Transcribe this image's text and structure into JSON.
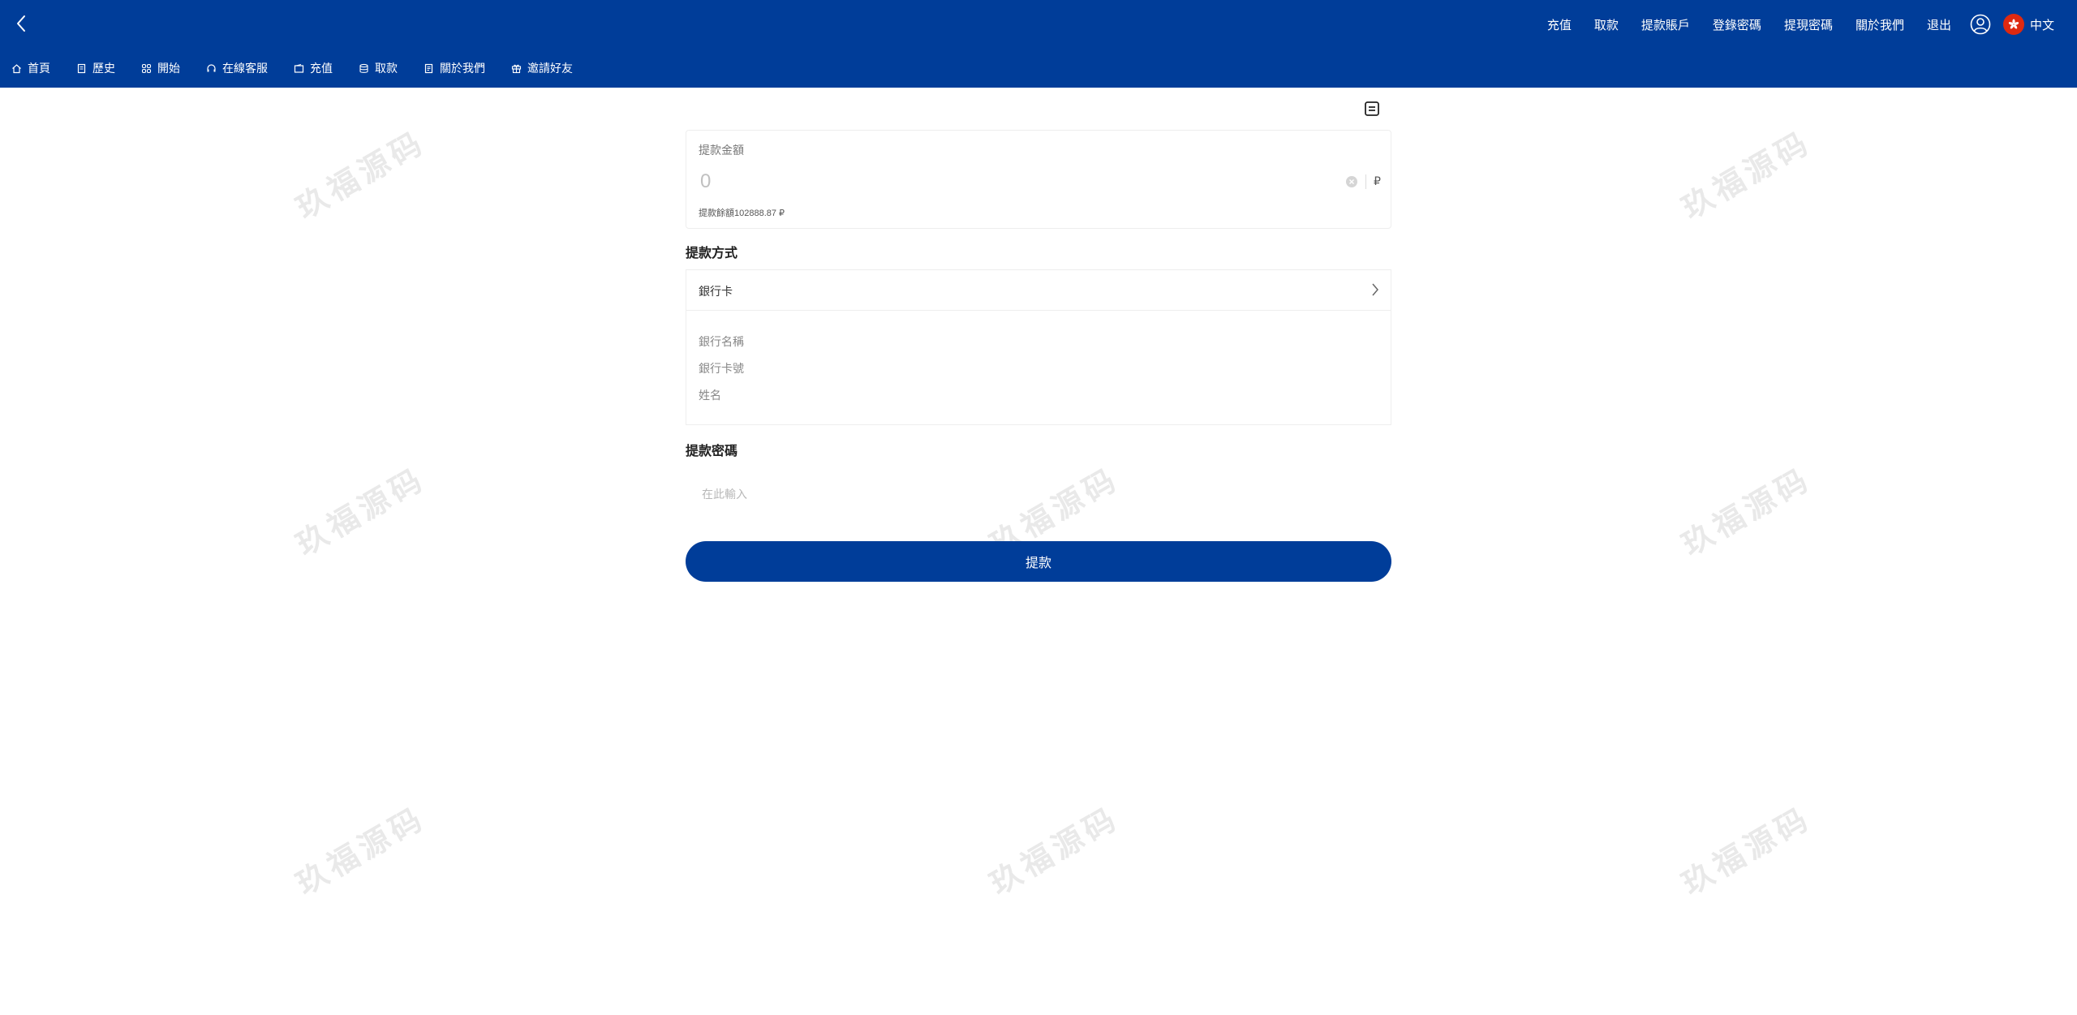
{
  "topbar": {
    "links": [
      "充值",
      "取款",
      "提款賬戶",
      "登錄密碼",
      "提現密碼",
      "關於我們",
      "退出"
    ],
    "language": "中文"
  },
  "nav": {
    "items": [
      {
        "label": "首頁",
        "icon": "home-icon"
      },
      {
        "label": "歷史",
        "icon": "document-icon"
      },
      {
        "label": "開始",
        "icon": "grid-icon"
      },
      {
        "label": "在線客服",
        "icon": "headset-icon"
      },
      {
        "label": "充值",
        "icon": "wallet-icon"
      },
      {
        "label": "取款",
        "icon": "database-icon"
      },
      {
        "label": "關於我們",
        "icon": "file-icon"
      },
      {
        "label": "邀請好友",
        "icon": "gift-icon"
      }
    ]
  },
  "watermark": "玖福源码",
  "withdraw": {
    "amount_label": "提款金額",
    "amount_placeholder": "0",
    "currency": "₽",
    "balance_text": "提款餘額102888.87 ₽",
    "method_title": "提款方式",
    "method_value": "銀行卡",
    "bank_fields": [
      "銀行名稱",
      "銀行卡號",
      "姓名"
    ],
    "password_title": "提款密碼",
    "password_placeholder": "在此輸入",
    "submit_label": "提款"
  },
  "colors": {
    "brand": "#003d99",
    "flag": "#de2910"
  }
}
